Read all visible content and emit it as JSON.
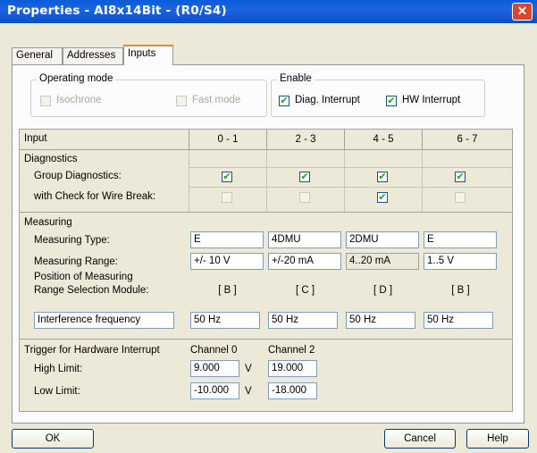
{
  "window": {
    "title": "Properties - AI8x14Bit - (R0/S4)",
    "close_glyph": "✕"
  },
  "tabs": [
    {
      "label": "General"
    },
    {
      "label": "Addresses"
    },
    {
      "label": "Inputs",
      "active": true
    }
  ],
  "operating_mode": {
    "label": "Operating mode",
    "isochrone": {
      "label": "Isochrone",
      "checked": false,
      "enabled": false
    },
    "fast_mode": {
      "label": "Fast mode",
      "checked": false,
      "enabled": false
    }
  },
  "enable": {
    "label": "Enable",
    "diag_interrupt": {
      "label": "Diag. Interrupt",
      "checked": true
    },
    "hw_interrupt": {
      "label": "HW Interrupt",
      "checked": true
    }
  },
  "table": {
    "header": {
      "input": "Input",
      "channels": [
        "0 - 1",
        "2 - 3",
        "4 - 5",
        "6 - 7"
      ]
    },
    "diagnostics": {
      "label": "Diagnostics",
      "group_diagnostics": {
        "label": "Group Diagnostics:",
        "values": [
          true,
          true,
          true,
          true
        ],
        "enabled": [
          true,
          true,
          true,
          true
        ]
      },
      "wire_break": {
        "label": "with Check for Wire Break:",
        "values": [
          false,
          false,
          true,
          false
        ],
        "enabled": [
          false,
          false,
          true,
          false
        ]
      }
    },
    "measuring": {
      "label": "Measuring",
      "type": {
        "label": "Measuring Type:",
        "values": [
          "E",
          "4DMU",
          "2DMU",
          "E"
        ]
      },
      "range": {
        "label": "Measuring Range:",
        "values": [
          "+/- 10 V",
          "+/-20 mA",
          "4..20 mA",
          "1..5 V"
        ],
        "readonly": [
          false,
          false,
          true,
          false
        ]
      },
      "position": {
        "label_line1": "Position of Measuring",
        "label_line2": "Range Selection Module:",
        "values": [
          "[ B ]",
          "[ C ]",
          "[ D ]",
          "[ B ]"
        ]
      },
      "interference": {
        "label": "Interference frequency",
        "values": [
          "50 Hz",
          "50 Hz",
          "50 Hz",
          "50 Hz"
        ]
      }
    },
    "trigger": {
      "label": "Trigger for Hardware Interrupt",
      "channels": [
        "Channel 0",
        "Channel 2"
      ],
      "high": {
        "label": "High Limit:",
        "values": [
          "9.000",
          "19.000"
        ],
        "unit": "V"
      },
      "low": {
        "label": "Low Limit:",
        "values": [
          "-10.000",
          "-18.000"
        ],
        "unit": "V"
      }
    }
  },
  "buttons": {
    "ok": "OK",
    "cancel": "Cancel",
    "help": "Help"
  },
  "colors": {
    "titlebar": "#0a5bd8",
    "dialog_bg": "#ece9d8",
    "check": "#21a121"
  }
}
